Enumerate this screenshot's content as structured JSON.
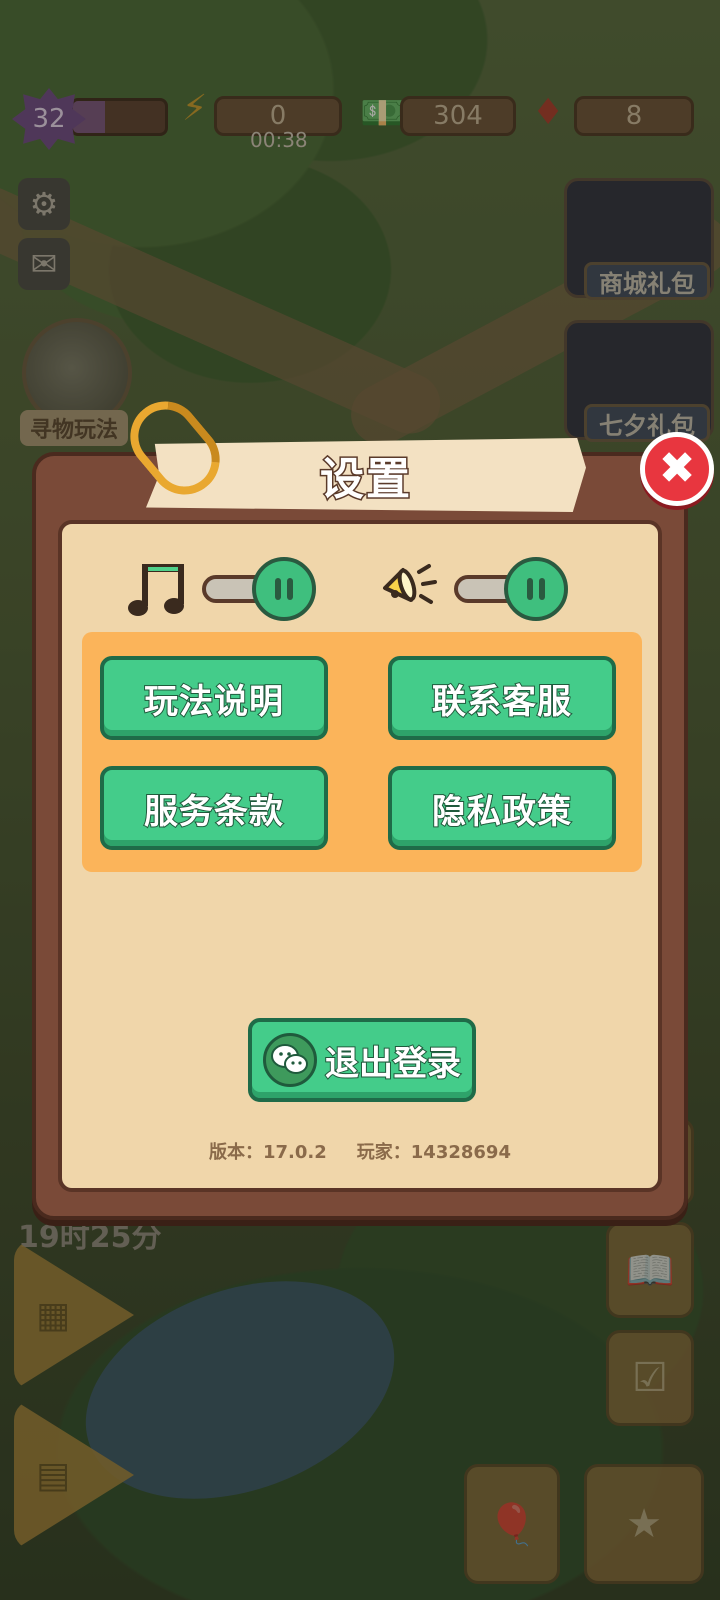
{
  "hud": {
    "level": "32",
    "energy": "0",
    "energy_timer": "00:38",
    "cash": "304",
    "gems": "8"
  },
  "background": {
    "shop_pack_label": "商城礼包",
    "festival_pack_label": "七夕礼包",
    "find_mode_label": "寻物玩法",
    "clock_text": "19时25分"
  },
  "dialog": {
    "title": "设置",
    "close_symbol": "✖",
    "music_toggle": {
      "state": "on"
    },
    "sound_toggle": {
      "state": "on"
    },
    "buttons": {
      "how_to_play": "玩法说明",
      "contact_support": "联系客服",
      "terms_of_service": "服务条款",
      "privacy_policy": "隐私政策"
    },
    "logout_label": "退出登录",
    "version_text": "版本：17.0.2",
    "player_text": "玩家：14328694"
  },
  "colors": {
    "panel_brown": "#7a4a38",
    "panel_cream": "#f0d6aa",
    "button_green": "#44cc8a",
    "panel_orange": "#fbb45a",
    "close_red": "#e8363f"
  }
}
